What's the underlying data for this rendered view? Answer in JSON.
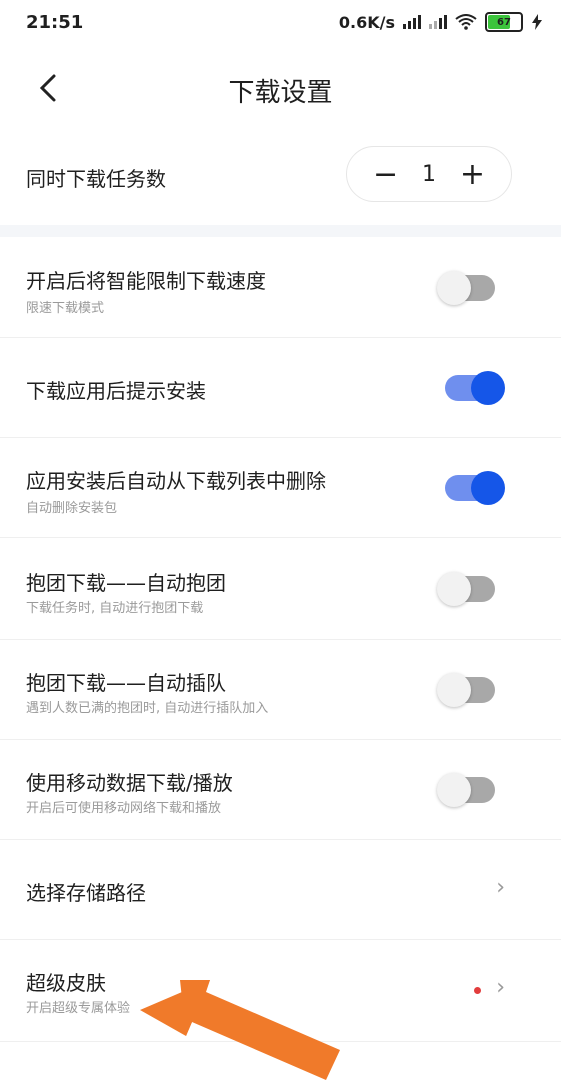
{
  "status": {
    "time": "21:51",
    "speed": "0.6K/s",
    "battery": "67"
  },
  "header": {
    "title": "下载设置"
  },
  "task_count": {
    "label": "同时下载任务数",
    "value": "1",
    "minus": "−",
    "plus": "+"
  },
  "settings": [
    {
      "label": "开启后将智能限制下载速度",
      "sub": "限速下载模式",
      "on": false
    },
    {
      "label": "下载应用后提示安装",
      "sub": "",
      "on": true
    },
    {
      "label": "应用安装后自动从下载列表中删除",
      "sub": "自动删除安装包",
      "on": true
    },
    {
      "label": "抱团下载——自动抱团",
      "sub": "下载任务时, 自动进行抱团下载",
      "on": false
    },
    {
      "label": "抱团下载——自动插队",
      "sub": "遇到人数已满的抱团时, 自动进行插队加入",
      "on": false
    },
    {
      "label": "使用移动数据下载/播放",
      "sub": "开启后可使用移动网络下载和播放",
      "on": false
    }
  ],
  "storage": {
    "label": "选择存储路径"
  },
  "skin": {
    "label": "超级皮肤",
    "sub": "开启超级专属体验"
  },
  "icons": {
    "back": "back-arrow-icon",
    "chevron": "chevron-right-icon"
  },
  "colors": {
    "toggle_on": "#1556e8",
    "toggle_off": "#a8a8a8",
    "arrow": "#f07a2a"
  }
}
